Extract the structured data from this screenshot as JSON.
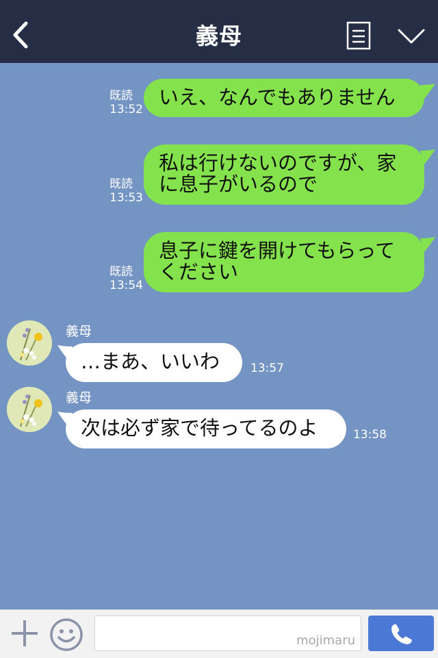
{
  "header": {
    "title": "義母",
    "back_icon": "chevron-left-icon",
    "notes_icon": "notes-icon",
    "menu_icon": "chevron-down-icon"
  },
  "messages_sent": [
    {
      "read": "既読",
      "time": "13:52",
      "lines": [
        "いえ、なんでもありません"
      ]
    },
    {
      "read": "既読",
      "time": "13:53",
      "lines": [
        "私は行けないのですが、家",
        "に息子がいるので"
      ]
    },
    {
      "read": "既読",
      "time": "13:54",
      "lines": [
        "息子に鍵を開けてもらって",
        "ください"
      ]
    }
  ],
  "messages_received": [
    {
      "sender": "義母",
      "text": "…まあ、いいわ",
      "time": "13:57"
    },
    {
      "sender": "義母",
      "text": "次は必ず家で待ってるのよ",
      "time": "13:58"
    }
  ],
  "footer": {
    "input_value": "",
    "watermark": "mojimaru",
    "plus_icon": "plus-icon",
    "emoji_icon": "emoji-icon",
    "call_icon": "phone-icon"
  },
  "colors": {
    "header_bg": "#252e44",
    "chat_bg": "#7494c3",
    "sent_bubble": "#84e24c",
    "received_bubble": "#ffffff",
    "call_button": "#4a78d4"
  }
}
